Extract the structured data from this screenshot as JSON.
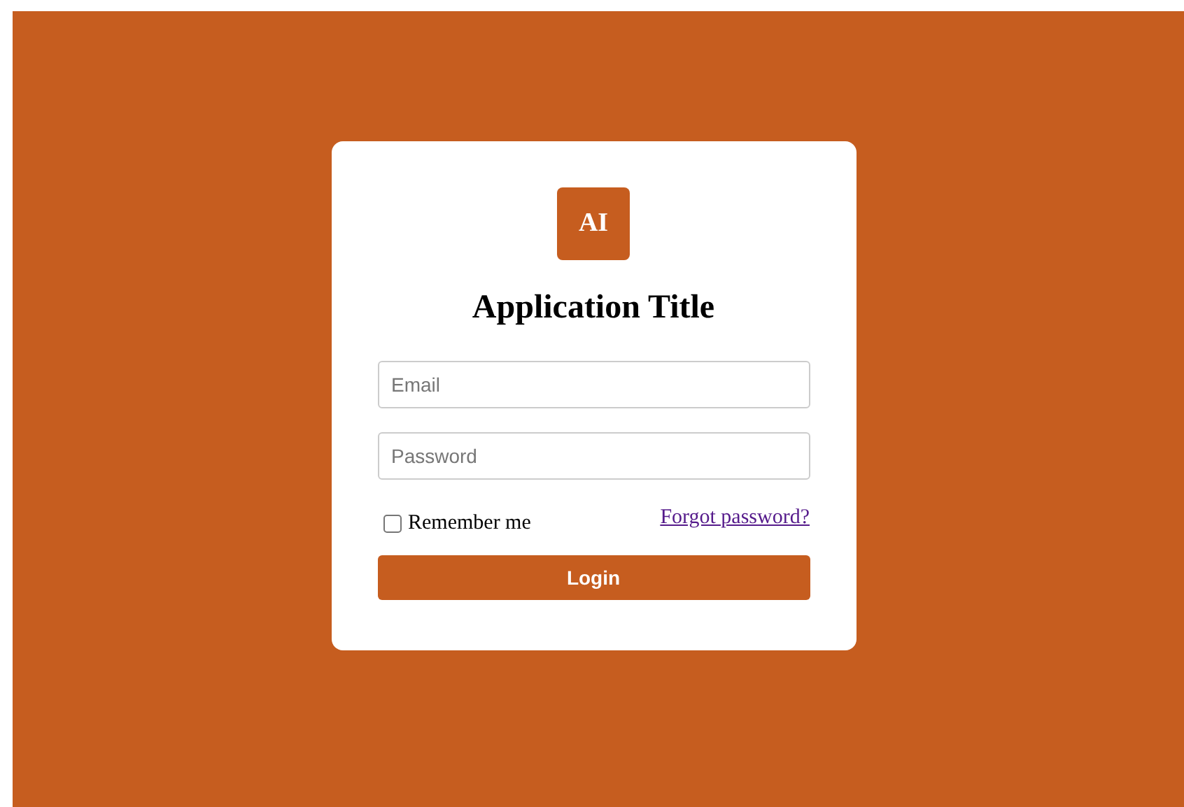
{
  "logo": {
    "text": "AI"
  },
  "title": "Application Title",
  "fields": [
    {
      "placeholder": "Email"
    },
    {
      "placeholder": "Password"
    }
  ],
  "remember": {
    "label": "Remember me",
    "checked": false
  },
  "forgot_link": "Forgot password?",
  "login_button": "Login"
}
